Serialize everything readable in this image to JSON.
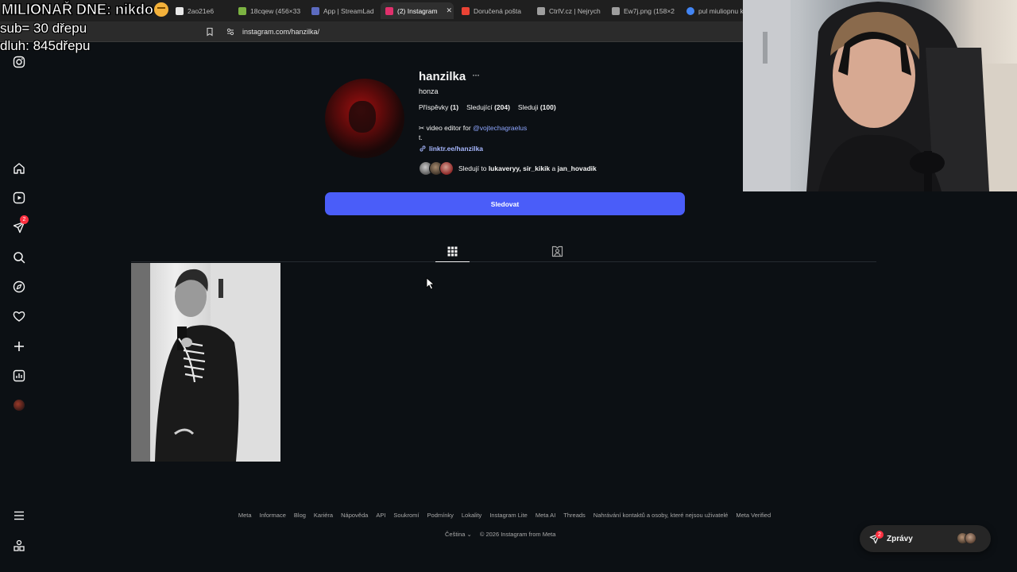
{
  "browser": {
    "tabs": [
      {
        "label": "2ao21e6",
        "favicon_color": "#e8e8e8",
        "active": false
      },
      {
        "label": "18cqew (456×33",
        "favicon_color": "#7cb342",
        "active": false
      },
      {
        "label": "App | StreamLad",
        "favicon_color": "#5c6bc0",
        "active": false
      },
      {
        "label": "(2) Instagram",
        "favicon_color": "#e1306c",
        "active": true
      },
      {
        "label": "Doručená pošta",
        "favicon_color": "#ea4335",
        "active": false
      },
      {
        "label": "CtrlV.cz | Nejrych",
        "favicon_color": "#9e9e9e",
        "active": false
      },
      {
        "label": "Ew7j.png (158×2",
        "favicon_color": "#9e9e9e",
        "active": false
      },
      {
        "label": "pul miuliopnu k",
        "favicon_color": "#4285f4",
        "active": false
      }
    ],
    "tab_close": "✕",
    "url": "instagram.com/hanzilka/"
  },
  "overlay": {
    "line1": "MILIONAŘ DNE: nikdo",
    "line2": "sub= 30 dřepu",
    "line3": "dluh: 845dřepu"
  },
  "sidebar": {
    "notification_count": "2",
    "items": [
      "instagram-logo",
      "home",
      "reels",
      "messages",
      "search",
      "explore",
      "notifications",
      "create",
      "dashboard",
      "profile",
      "more",
      "also-from-meta"
    ]
  },
  "profile": {
    "username": "hanzilka",
    "more": "···",
    "full_name": "honza",
    "stats": {
      "posts_label": "Příspěvky",
      "posts_count": "(1)",
      "followers_label": "Sledující",
      "followers_count": "(204)",
      "following_label": "Sleduji",
      "following_count": "(100)"
    },
    "bio_line1_prefix": "✂ video editor for ",
    "bio_mention": "@vojtechagraelus",
    "bio_line2": "t.",
    "link": "linktr.ee/hanzilka",
    "followed_by_prefix": "Sledují to ",
    "followed_by_names": "lukaveryy, sir_kikik",
    "followed_by_and": " a ",
    "followed_by_last": "jan_hovadik",
    "follow_button": "Sledovat"
  },
  "footer": {
    "links": [
      "Meta",
      "Informace",
      "Blog",
      "Kariéra",
      "Nápověda",
      "API",
      "Soukromí",
      "Podmínky",
      "Lokality",
      "Instagram Lite",
      "Meta AI",
      "Threads",
      "Nahrávání kontaktů a osoby, které nejsou uživatelé",
      "Meta Verified"
    ],
    "language": "Čeština",
    "copyright": "© 2026 Instagram from Meta"
  },
  "messages": {
    "label": "Zprávy",
    "badge": "2"
  },
  "colors": {
    "background": "#0c1014",
    "accent": "#4a5df9",
    "link": "#8ea6ff",
    "badge": "#ff3040"
  }
}
